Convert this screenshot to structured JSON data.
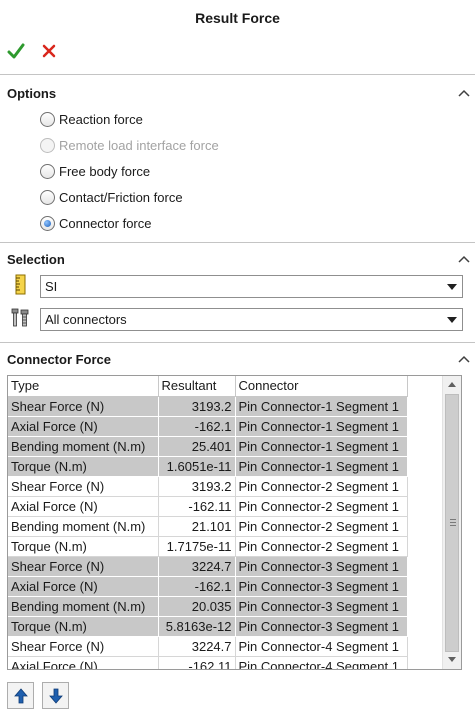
{
  "header": {
    "title": "Result Force",
    "ok_icon": "checkmark-icon",
    "cancel_icon": "close-x-icon",
    "ok_color": "#2e9a2e",
    "cancel_color": "#d9261c"
  },
  "options": {
    "title": "Options",
    "radios": [
      {
        "label": "Reaction force",
        "checked": false,
        "disabled": false
      },
      {
        "label": "Remote load interface force",
        "checked": false,
        "disabled": true
      },
      {
        "label": "Free body force",
        "checked": false,
        "disabled": false
      },
      {
        "label": "Contact/Friction force",
        "checked": false,
        "disabled": false
      },
      {
        "label": "Connector force",
        "checked": true,
        "disabled": false
      }
    ]
  },
  "selection": {
    "title": "Selection",
    "units": {
      "icon": "ruler-icon",
      "value": "SI"
    },
    "connectors": {
      "icon": "bolt-connector-icon",
      "value": "All connectors"
    }
  },
  "connector_force": {
    "title": "Connector Force",
    "columns": [
      "Type",
      "Resultant",
      "Connector"
    ],
    "rows": [
      {
        "type": "Shear Force (N)",
        "resultant": "3193.2",
        "connector": "Pin Connector-1 Segment 1",
        "shaded": true
      },
      {
        "type": "Axial Force (N)",
        "resultant": "-162.1",
        "connector": "Pin Connector-1 Segment 1",
        "shaded": true
      },
      {
        "type": "Bending moment (N.m)",
        "resultant": "25.401",
        "connector": "Pin Connector-1 Segment 1",
        "shaded": true
      },
      {
        "type": "Torque (N.m)",
        "resultant": "1.6051e-11",
        "connector": "Pin Connector-1 Segment 1",
        "shaded": true
      },
      {
        "type": "Shear Force (N)",
        "resultant": "3193.2",
        "connector": "Pin Connector-2 Segment 1",
        "shaded": false
      },
      {
        "type": "Axial Force (N)",
        "resultant": "-162.11",
        "connector": "Pin Connector-2 Segment 1",
        "shaded": false
      },
      {
        "type": "Bending moment (N.m)",
        "resultant": "21.101",
        "connector": "Pin Connector-2 Segment 1",
        "shaded": false
      },
      {
        "type": "Torque (N.m)",
        "resultant": "1.7175e-11",
        "connector": "Pin Connector-2 Segment 1",
        "shaded": false
      },
      {
        "type": "Shear Force (N)",
        "resultant": "3224.7",
        "connector": "Pin Connector-3 Segment 1",
        "shaded": true
      },
      {
        "type": "Axial Force (N)",
        "resultant": "-162.1",
        "connector": "Pin Connector-3 Segment 1",
        "shaded": true
      },
      {
        "type": "Bending moment (N.m)",
        "resultant": "20.035",
        "connector": "Pin Connector-3 Segment 1",
        "shaded": true
      },
      {
        "type": "Torque (N.m)",
        "resultant": "5.8163e-12",
        "connector": "Pin Connector-3 Segment 1",
        "shaded": true
      },
      {
        "type": "Shear Force (N)",
        "resultant": "3224.7",
        "connector": "Pin Connector-4 Segment 1",
        "shaded": false
      },
      {
        "type": "Axial Force (N)",
        "resultant": "-162.11",
        "connector": "Pin Connector-4 Segment 1",
        "shaded": false
      }
    ]
  },
  "footer": {
    "up_icon": "move-up-arrow-icon",
    "down_icon": "move-down-arrow-icon",
    "arrow_color": "#1f5fae"
  }
}
